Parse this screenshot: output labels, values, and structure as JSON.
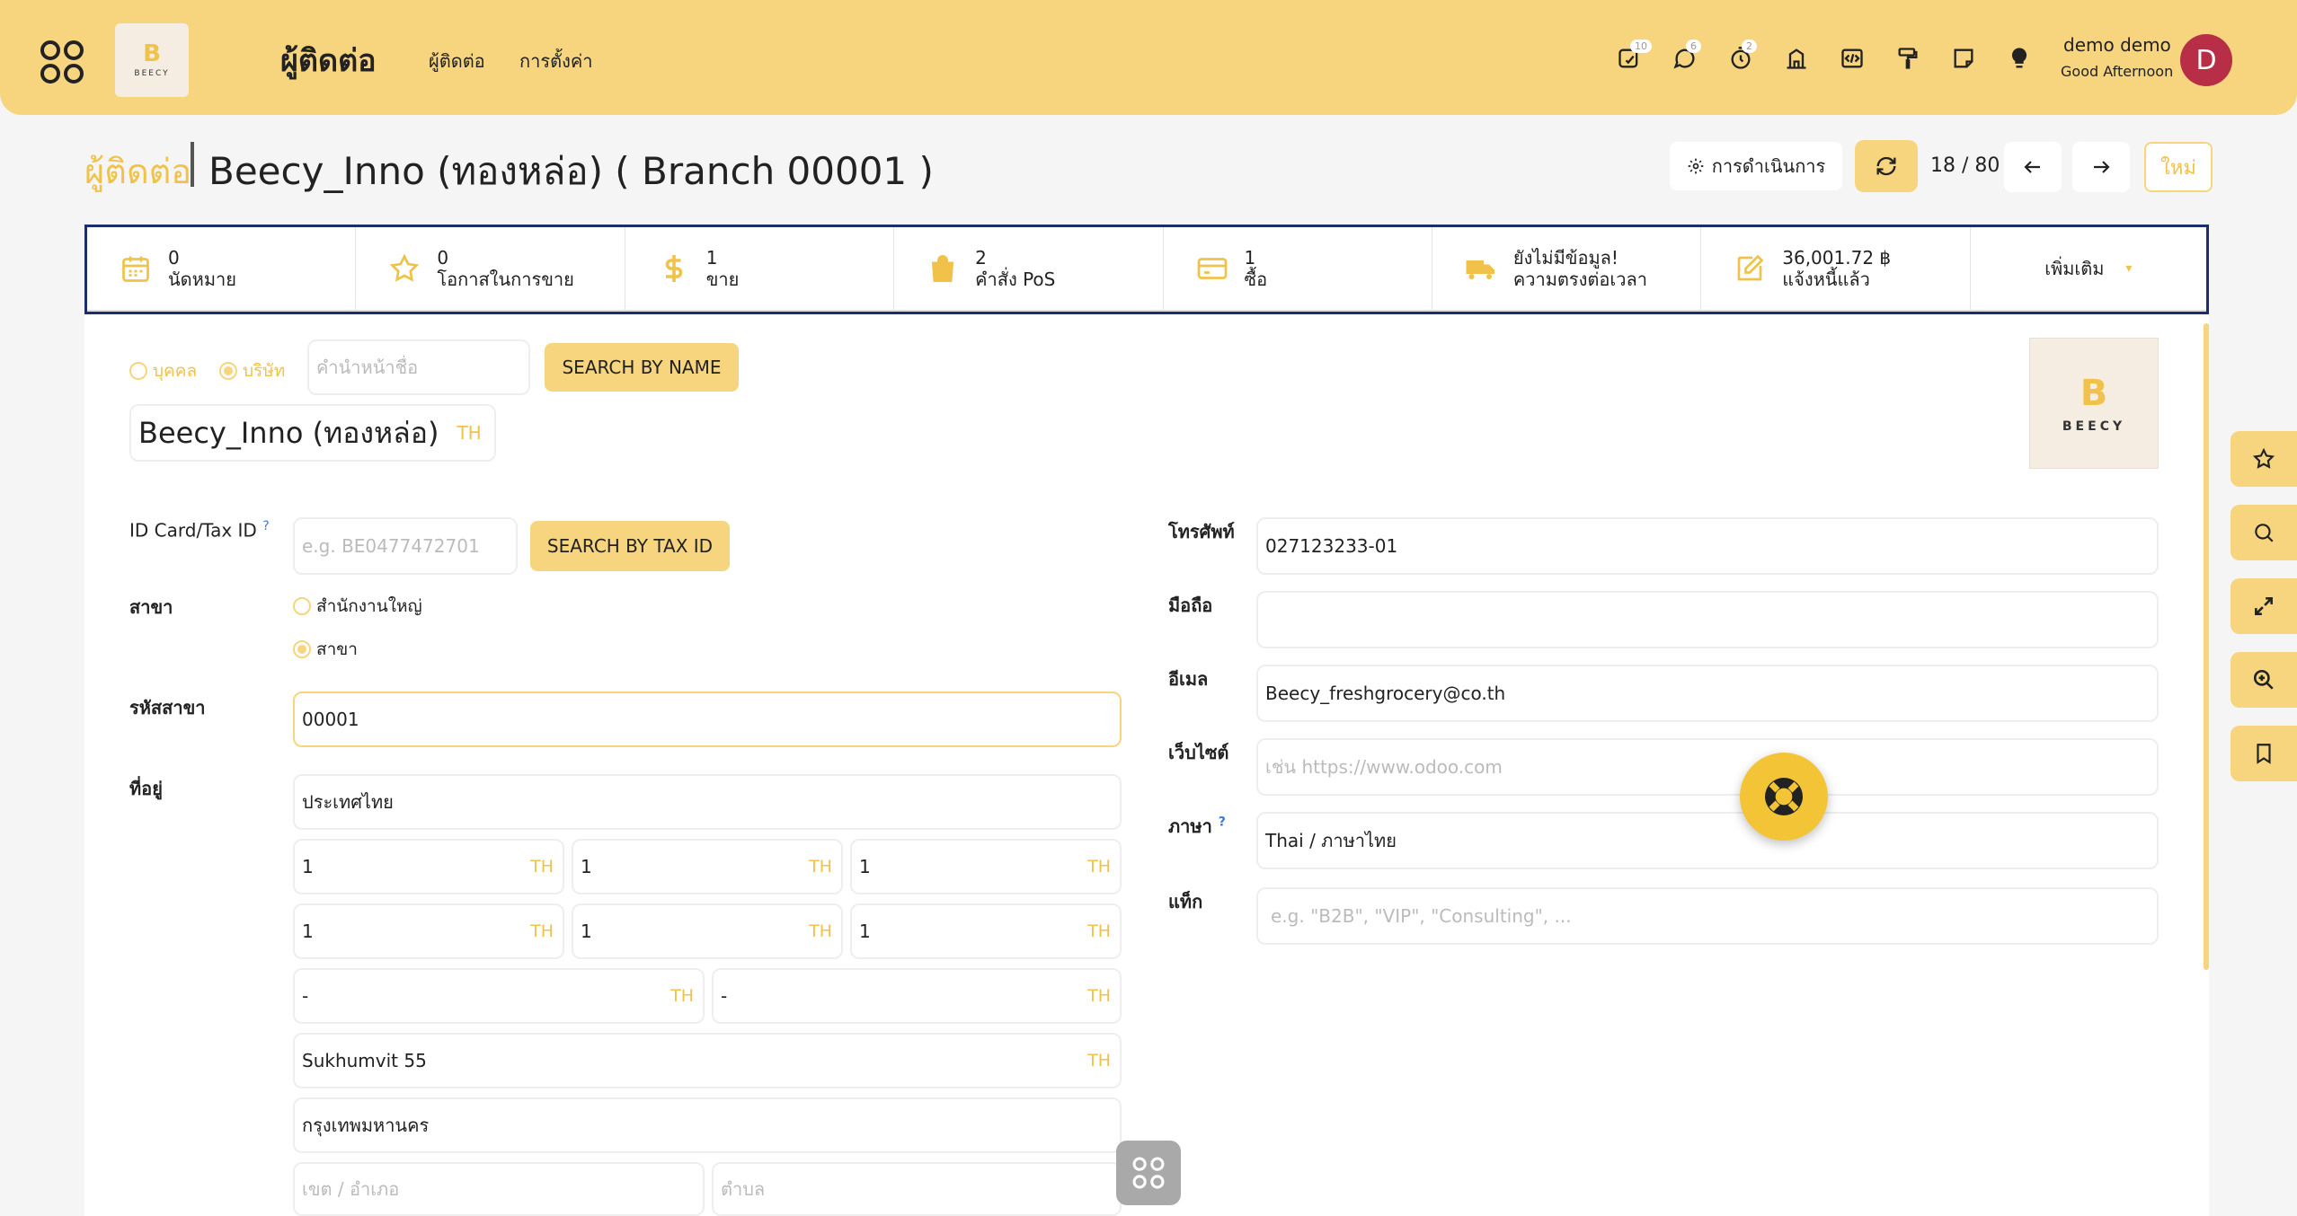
{
  "header": {
    "logo_text": "BEECY",
    "app_title": "ผู้ติดต่อ",
    "nav": [
      "ผู้ติดต่อ",
      "การตั้งค่า"
    ],
    "badges": {
      "activity": "10",
      "messages": "6",
      "timer": "2"
    },
    "user_name": "demo demo",
    "greeting": "Good Afternoon",
    "avatar_letter": "D"
  },
  "breadcrumb": {
    "parent": "ผู้ติดต่อ",
    "current": "Beecy_Inno (ทองหล่อ) ( Branch 00001 )"
  },
  "controls": {
    "action_label": "การดำเนินการ",
    "pager": "18 / 80",
    "new_label": "ใหม่"
  },
  "smart_buttons": [
    {
      "value": "0",
      "label": "นัดหมาย",
      "icon": "calendar-icon"
    },
    {
      "value": "0",
      "label": "โอกาสในการขาย",
      "icon": "star-icon"
    },
    {
      "value": "1",
      "label": "ขาย",
      "icon": "dollar-icon"
    },
    {
      "value": "2",
      "label": "คำสั่ง PoS",
      "icon": "shopping-bag-icon"
    },
    {
      "value": "1",
      "label": "ซื้อ",
      "icon": "credit-card-icon"
    },
    {
      "value": "ยังไม่มีข้อมูล!",
      "label": "ความตรงต่อเวลา",
      "icon": "truck-icon"
    },
    {
      "value": "36,001.72 ฿",
      "label": "แจ้งหนี้แล้ว",
      "icon": "edit-icon"
    }
  ],
  "more_label": "เพิ่มเติม",
  "form": {
    "type_person": "บุคคล",
    "type_company": "บริษัท",
    "title_placeholder": "คำนำหน้าชื่อ",
    "search_by_name": "SEARCH BY NAME",
    "name": "Beecy_Inno (ทองหล่อ)",
    "lang_tag": "TH",
    "tax_id_label": "ID Card/Tax ID",
    "tax_id_help": "?",
    "tax_id_placeholder": "e.g. BE0477472701",
    "search_by_tax": "SEARCH BY TAX ID",
    "branch_label": "สาขา",
    "branch_opt_hq": "สำนักงานใหญ่",
    "branch_opt_branch": "สาขา",
    "branch_code_label": "รหัสสาขา",
    "branch_code": "00001",
    "address_label": "ที่อยู่",
    "country": "ประเทศไทย",
    "addr_row1": [
      "1",
      "1",
      "1"
    ],
    "addr_row2": [
      "1",
      "1",
      "1"
    ],
    "addr_row3": [
      "-",
      "-"
    ],
    "street": "Sukhumvit 55",
    "province": "กรุงเทพมหานคร",
    "district_placeholder": "เขต / อำเภอ",
    "subdistrict_placeholder": "ตำบล",
    "phone_label": "โทรศัพท์",
    "phone": "027123233-01",
    "mobile_label": "มือถือ",
    "mobile": "",
    "email_label": "อีเมล",
    "email": "Beecy_freshgrocery@co.th",
    "website_label": "เว็บไซต์",
    "website_placeholder": "เช่น https://www.odoo.com",
    "language_label": "ภาษา",
    "language_help": "?",
    "language": "Thai / ภาษาไทย",
    "tags_label": "แท็ก",
    "tags_placeholder": "e.g. \"B2B\", \"VIP\", \"Consulting\", ..."
  },
  "colors": {
    "accent": "#f7d57e",
    "accent_text": "#f0c24a",
    "focus_border": "#1a2e6e",
    "avatar": "#b72e46"
  }
}
